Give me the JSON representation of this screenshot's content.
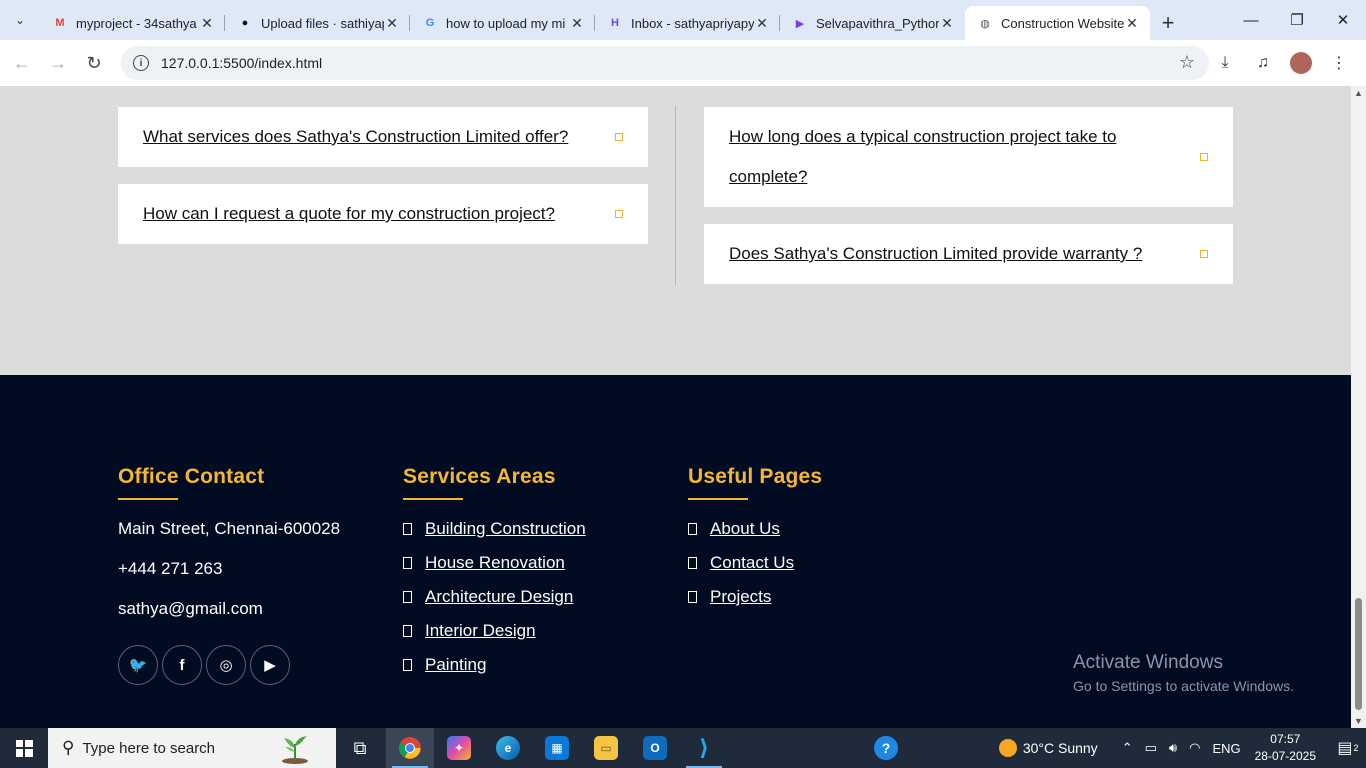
{
  "browser": {
    "tabs": [
      {
        "title": "myproject - 34sathya",
        "favicon": "gmail-icon",
        "color": "#ea4335",
        "glyph": "M"
      },
      {
        "title": "Upload files · sathiyap",
        "favicon": "github-icon",
        "color": "#111111",
        "glyph": "●"
      },
      {
        "title": "how to upload my mi",
        "favicon": "google-icon",
        "color": "#4285f4",
        "glyph": "G"
      },
      {
        "title": "Inbox - sathyapriyapy",
        "favicon": "mail-app-icon",
        "color": "#6a4cdb",
        "glyph": "H"
      },
      {
        "title": "Selvapavithra_Python",
        "favicon": "video-icon",
        "color": "#7b3fe4",
        "glyph": "▶"
      },
      {
        "title": "Construction Website",
        "favicon": "globe-icon",
        "color": "#555555",
        "glyph": "◍"
      }
    ],
    "active_tab": 5,
    "url": "127.0.0.1:5500/index.html"
  },
  "faq": {
    "left": [
      {
        "question": "What services does Sathya's Construction Limited offer?"
      },
      {
        "question": "How can I request a quote for my construction project?"
      }
    ],
    "right": [
      {
        "question": "How long does a typical construction project take to complete?"
      },
      {
        "question": "Does Sathya's Construction Limited provide warranty ?"
      }
    ],
    "accent": "#f3b132"
  },
  "footer": {
    "office": {
      "heading": "Office Contact",
      "address": "Main Street, Chennai-600028",
      "phone": "+444 271 263",
      "email": "sathya@gmail.com",
      "socials": [
        {
          "name": "twitter-icon",
          "glyph": "🐦"
        },
        {
          "name": "facebook-icon",
          "glyph": "f"
        },
        {
          "name": "instagram-icon",
          "glyph": "◎"
        },
        {
          "name": "youtube-icon",
          "glyph": "▶"
        }
      ]
    },
    "services": {
      "heading": "Services Areas",
      "links": [
        "Building Construction",
        "House Renovation",
        "Architecture Design",
        "Interior Design",
        "Painting"
      ]
    },
    "pages": {
      "heading": "Useful Pages",
      "links": [
        "About Us",
        "Contact Us",
        "Projects"
      ]
    },
    "accent": "#f6b635",
    "background": "#010b22"
  },
  "watermark": {
    "title": "Activate Windows",
    "subtitle": "Go to Settings to activate Windows."
  },
  "taskbar": {
    "search_placeholder": "Type here to search",
    "weather": "30°C  Sunny",
    "language": "ENG",
    "time": "07:57",
    "date": "28-07-2025",
    "notifications": "2"
  }
}
